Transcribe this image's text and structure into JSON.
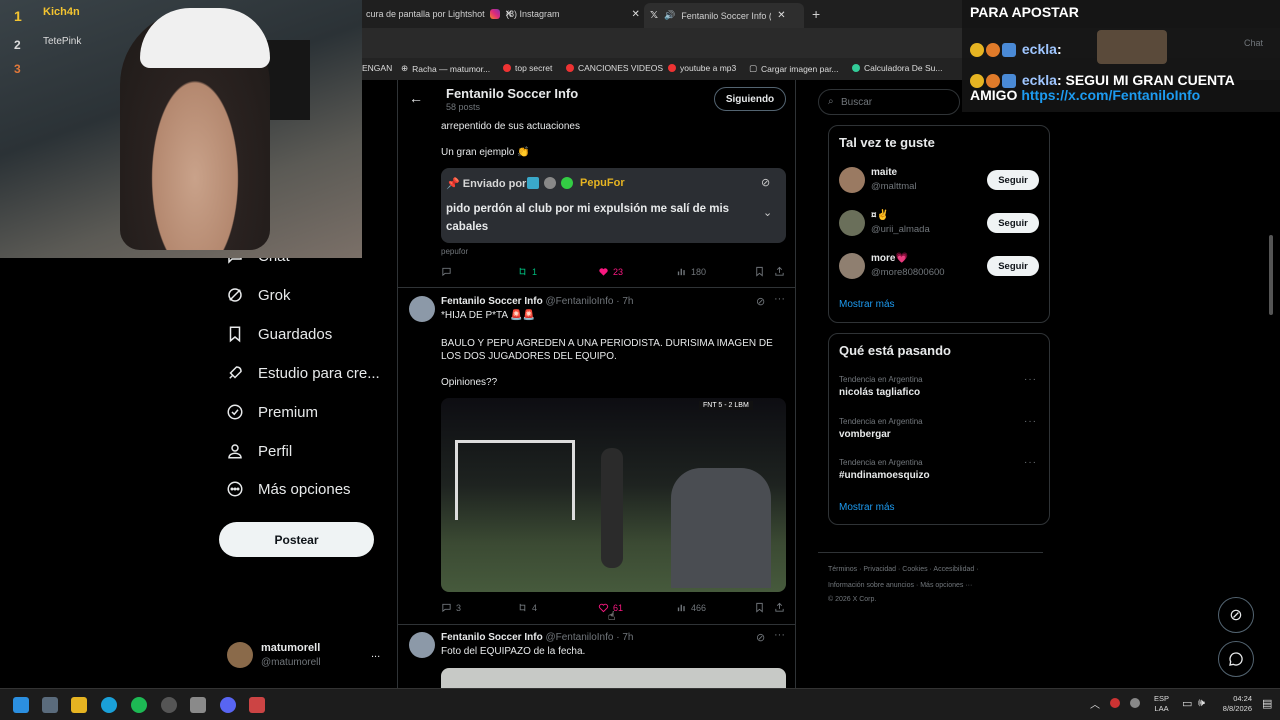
{
  "browser": {
    "tabs": [
      {
        "label": "cura de pantalla por Lightshot"
      },
      {
        "label": "(8) Instagram"
      },
      {
        "label": "Fentanilo Soccer Info (@Fent"
      }
    ],
    "new_tab": "+",
    "bookmarks": [
      "ENGAN",
      "Racha — matumor...",
      "top secret",
      "CANCIONES VIDEOS",
      "youtube a mp3",
      "Cargar imagen par...",
      "Calculadora De Su..."
    ]
  },
  "sidebar": {
    "items": [
      {
        "label": "Chat",
        "icon": "chat-icon"
      },
      {
        "label": "Grok",
        "icon": "grok-icon"
      },
      {
        "label": "Guardados",
        "icon": "bookmark-icon"
      },
      {
        "label": "Estudio para cre...",
        "icon": "rocket-icon"
      },
      {
        "label": "Premium",
        "icon": "verified-icon"
      },
      {
        "label": "Perfil",
        "icon": "person-icon"
      },
      {
        "label": "Más opciones",
        "icon": "more-circle-icon"
      }
    ],
    "post_button": "Postear",
    "account": {
      "name": "matumorell",
      "handle": "@matumorell",
      "more": "..."
    }
  },
  "header": {
    "title": "Fentanilo Soccer Info",
    "subtitle": "58 posts",
    "follow_state": "Siguiendo"
  },
  "posts": [
    {
      "partial_text": "arrepentido de sus actuaciones",
      "example_text": "Un gran ejemplo 👏",
      "embedded": {
        "sent_by": "📌 Enviado por",
        "sender": "PepuFor",
        "message": "pido perdón al club por mi expulsión me salí de mis cabales"
      },
      "caption": "pepufor",
      "stats": {
        "replies": "",
        "reposts": "1",
        "likes": "23",
        "views": "180"
      }
    },
    {
      "author": "Fentanilo Soccer Info",
      "handle": "@FentaniloInfo",
      "time": "· 7h",
      "text1": "*HIJA DE P*TA 🚨🚨",
      "text2": "BAULO Y PEPU AGREDEN A UNA PERIODISTA. DURISIMA IMAGEN DE LOS DOS JUGADORES DEL EQUIPO.",
      "text3": "Opiniones??",
      "scoreboard": "FNT 5 - 2 LBM",
      "stats": {
        "replies": "3",
        "reposts": "4",
        "likes": "61",
        "views": "466"
      }
    },
    {
      "author": "Fentanilo Soccer Info",
      "handle": "@FentaniloInfo",
      "time": "· 7h",
      "text1": "Foto del EQUIPAZO de la fecha."
    }
  ],
  "right": {
    "search_placeholder": "Buscar",
    "suggest_title": "Tal vez te guste",
    "suggestions": [
      {
        "name": "maite",
        "handle": "@malttmal",
        "button": "Seguir"
      },
      {
        "name": "¤✌️",
        "handle": "@urii_almada",
        "button": "Seguir"
      },
      {
        "name": "more💗",
        "handle": "@more80800600",
        "button": "Seguir"
      }
    ],
    "show_more": "Mostrar más",
    "trends_title": "Qué está pasando",
    "trends": [
      {
        "meta": "Tendencia en Argentina",
        "name": "nicolás tagliafico"
      },
      {
        "meta": "Tendencia en Argentina",
        "name": "vombergar"
      },
      {
        "meta": "Tendencia en Argentina",
        "name": "#undinamoesquizo"
      }
    ],
    "trends_more": "Mostrar más",
    "footer1": "Términos · Privacidad · Cookies · Accesibilidad ·",
    "footer2": "Información sobre anuncios · Más opciones ···",
    "footer3": "© 2026 X Corp."
  },
  "overlay": {
    "leaderboard": [
      {
        "rank": "1",
        "name": "Kich4n"
      },
      {
        "rank": "2",
        "name": "TetePink"
      },
      {
        "rank": "3",
        "name": ""
      }
    ],
    "chat": [
      {
        "text": "PARA APOSTAR"
      },
      {
        "user": "eckla",
        "text": ""
      },
      {
        "user": "eckla",
        "text": ": SEGUI MI GRAN CUENTA AMIGO",
        "link": "https://x.com/FentaniloInfo"
      }
    ],
    "chat_tab": "Chat"
  },
  "taskbar": {
    "lang": "ESP",
    "lang2": "LAA",
    "time": "04:24",
    "date": "8/8/2026"
  },
  "colors": {
    "like": "#f91880",
    "repost": "#00ba7c",
    "link": "#1d9bf0",
    "accent": "#eff3f4"
  }
}
